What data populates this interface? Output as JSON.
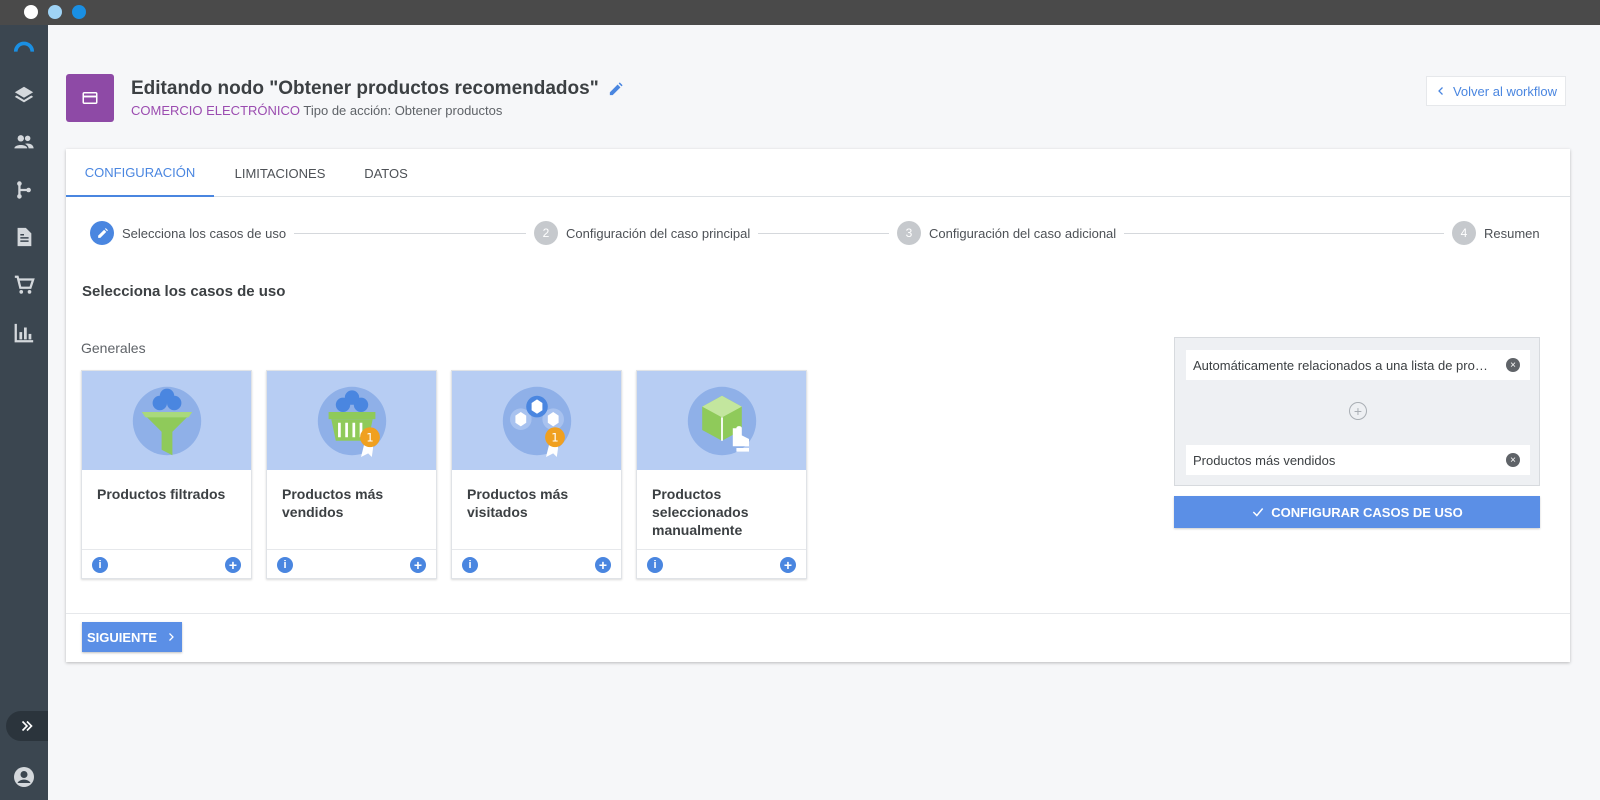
{
  "window": {
    "traffic_lights": [
      "#ffffff",
      "#9fd3f5",
      "#1a8fe3"
    ]
  },
  "sidebar": {
    "items": [
      {
        "icon": "logo-arc-icon"
      },
      {
        "icon": "layers-icon"
      },
      {
        "icon": "people-icon"
      },
      {
        "icon": "workflow-branch-icon"
      },
      {
        "icon": "document-icon"
      },
      {
        "icon": "cart-icon"
      },
      {
        "icon": "bar-chart-icon"
      }
    ],
    "expand_icon": "double-chevron-right-icon",
    "user_icon": "account-circle-icon"
  },
  "header": {
    "title": "Editando nodo \"Obtener productos recomendados\"",
    "category": "COMERCIO ELECTRÓNICO",
    "action_type": "Tipo de acción: Obtener productos",
    "back_label": "Volver al workflow",
    "accent_color": "#8e4aa6"
  },
  "tabs": [
    {
      "label": "CONFIGURACIÓN",
      "active": true
    },
    {
      "label": "LIMITACIONES",
      "active": false
    },
    {
      "label": "DATOS",
      "active": false
    }
  ],
  "stepper": [
    {
      "number": "",
      "label": "Selecciona los casos de uso",
      "active": true
    },
    {
      "number": "2",
      "label": "Configuración del caso principal",
      "active": false
    },
    {
      "number": "3",
      "label": "Configuración del caso adicional",
      "active": false
    },
    {
      "number": "4",
      "label": "Resumen",
      "active": false
    }
  ],
  "main": {
    "section_title": "Selecciona los casos de uso",
    "group_label": "Generales",
    "use_cases": [
      {
        "title": "Productos filtrados",
        "illustration": "funnel-cubes-icon"
      },
      {
        "title": "Productos más vendidos",
        "illustration": "basket-medal-icon"
      },
      {
        "title": "Productos más visitados",
        "illustration": "cubes-medal-icon"
      },
      {
        "title": "Productos seleccionados manualmente",
        "illustration": "cube-hand-icon"
      }
    ],
    "info_symbol": "i",
    "add_symbol": "+"
  },
  "selected": {
    "items": [
      {
        "label": "Automáticamente relacionados a una lista de productos"
      },
      {
        "label": "Productos más vendidos"
      }
    ],
    "add_symbol": "+",
    "remove_symbol": "×",
    "configure_label": "CONFIGURAR CASOS DE USO"
  },
  "footer": {
    "next_label": "SIGUIENTE"
  },
  "colors": {
    "primary": "#4a86e0",
    "sidebar": "#3b4650",
    "illustration_bg": "#b7cdf3"
  }
}
